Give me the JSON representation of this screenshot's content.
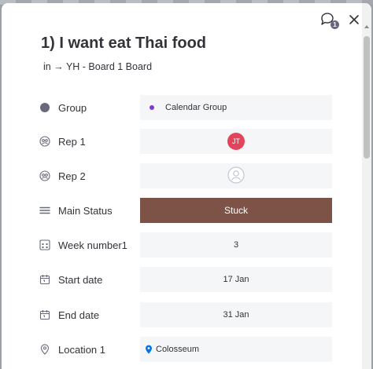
{
  "item": {
    "title": "1) I want eat Thai food",
    "breadcrumb": "in → YH - Board 1 Board"
  },
  "header": {
    "updates_count": "1"
  },
  "colors": {
    "status_stuck": "#7e5347",
    "group_dot": "#7e3bd0",
    "avatar_bg": "#e2445c",
    "location_pin": "#0073ea"
  },
  "columns": {
    "group": {
      "label": "Group",
      "value": "Calendar Group",
      "icon": "circle-icon"
    },
    "rep1": {
      "label": "Rep 1",
      "initials": "JT",
      "icon": "people-icon"
    },
    "rep2": {
      "label": "Rep 2",
      "icon": "people-icon"
    },
    "main_status": {
      "label": "Main Status",
      "value": "Stuck",
      "icon": "status-lines-icon"
    },
    "week_number": {
      "label": "Week number1",
      "value": "3",
      "icon": "numbers-icon"
    },
    "start_date": {
      "label": "Start date",
      "value": "17 Jan",
      "icon": "calendar-icon"
    },
    "end_date": {
      "label": "End date",
      "value": "31 Jan",
      "icon": "calendar-icon"
    },
    "location": {
      "label": "Location 1",
      "value": "Colosseum",
      "icon": "location-pin-icon"
    }
  }
}
